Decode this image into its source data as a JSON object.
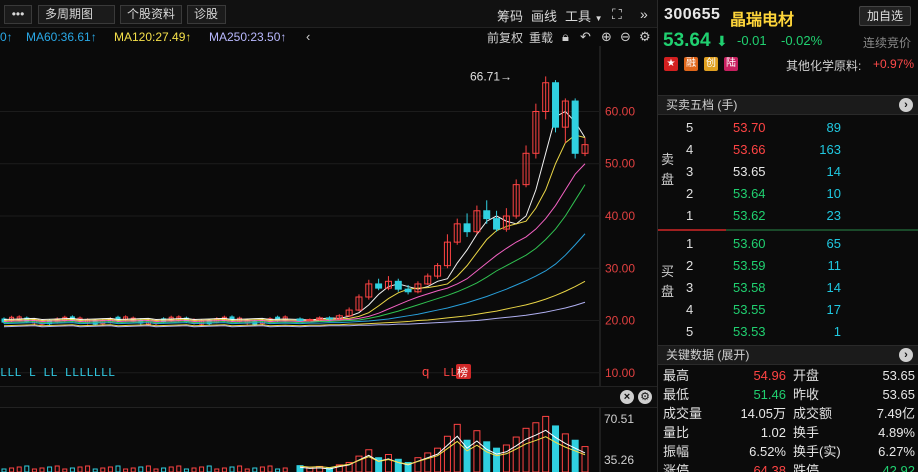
{
  "toolbar": {
    "more_label": "•••",
    "period_label": "多周期图",
    "profile_label": "个股资料",
    "diagnose_label": "诊股",
    "chips_label": "筹码",
    "draw_label": "画线",
    "tools_label": "工具"
  },
  "ma_bar": {
    "prev_label": "0↑",
    "ma60": "MA60:36.61↑",
    "ma120": "MA120:27.49↑",
    "ma250": "MA250:23.50↑",
    "colors": {
      "ma60": "#2aa8e6",
      "ma120": "#f5e04a",
      "ma250": "#b9b9ff"
    }
  },
  "chart_controls": {
    "adjust_label": "前复权",
    "overlay_label": "重载"
  },
  "chart_data": {
    "type": "candlestick",
    "title": "",
    "y_ticks": [
      "60.00",
      "50.00",
      "40.00",
      "30.00",
      "20.00",
      "10.00"
    ],
    "ylim": [
      9,
      71
    ],
    "high_label": "66.71→",
    "series": [
      {
        "name": "MA5",
        "values": [
          20.2,
          20.1,
          20.3,
          20.5,
          20.4,
          20.8,
          21.5,
          23.0,
          25.0,
          26.5,
          27.0,
          26.5,
          26.0,
          26.5,
          27.5,
          28.0,
          31.0,
          33.5,
          36.5,
          39.0,
          40.0,
          39.0,
          38.5,
          40.0,
          45.0,
          52.0,
          59.0,
          60.0,
          58.0,
          55.0
        ]
      },
      {
        "name": "MA10",
        "values": [
          20.0,
          20.0,
          20.1,
          20.2,
          20.3,
          20.4,
          20.8,
          21.5,
          22.8,
          24.2,
          25.3,
          26.0,
          26.2,
          26.3,
          26.6,
          27.0,
          28.5,
          30.5,
          33.0,
          35.5,
          37.2,
          38.0,
          38.5,
          39.0,
          41.5,
          45.0,
          50.0,
          54.0,
          55.5,
          55.0
        ]
      },
      {
        "name": "MA20",
        "values": [
          19.8,
          19.9,
          19.9,
          20.0,
          20.1,
          20.2,
          20.4,
          20.8,
          21.4,
          22.2,
          23.0,
          23.8,
          24.5,
          25.1,
          25.7,
          26.2,
          27.0,
          28.0,
          29.5,
          31.0,
          32.5,
          33.8,
          35.0,
          36.0,
          37.5,
          39.5,
          42.0,
          45.0,
          48.0,
          50.0
        ]
      },
      {
        "name": "MA30",
        "values": [
          19.6,
          19.7,
          19.8,
          19.8,
          19.9,
          20.0,
          20.1,
          20.4,
          20.8,
          21.3,
          21.8,
          22.4,
          23.0,
          23.6,
          24.2,
          24.8,
          25.5,
          26.3,
          27.2,
          28.3,
          29.5,
          30.5,
          31.5,
          32.5,
          33.8,
          35.5,
          37.5,
          40.0,
          43.0,
          46.0
        ]
      },
      {
        "name": "MA60",
        "values": [
          19.4,
          19.5,
          19.5,
          19.6,
          19.6,
          19.7,
          19.8,
          19.9,
          20.1,
          20.3,
          20.6,
          20.9,
          21.2,
          21.6,
          22.0,
          22.4,
          22.9,
          23.4,
          24.0,
          24.6,
          25.3,
          26.0,
          26.8,
          27.6,
          28.5,
          29.5,
          30.8,
          32.5,
          34.5,
          36.6
        ]
      },
      {
        "name": "MA120",
        "values": [
          19.0,
          19.1,
          19.1,
          19.2,
          19.2,
          19.3,
          19.3,
          19.4,
          19.5,
          19.6,
          19.7,
          19.8,
          20.0,
          20.1,
          20.3,
          20.5,
          20.7,
          20.9,
          21.2,
          21.5,
          21.8,
          22.2,
          22.6,
          23.0,
          23.5,
          24.1,
          24.8,
          25.6,
          26.5,
          27.5
        ]
      },
      {
        "name": "MA250",
        "values": [
          18.8,
          18.9,
          18.9,
          19.0,
          19.0,
          19.0,
          19.1,
          19.1,
          19.2,
          19.2,
          19.3,
          19.3,
          19.4,
          19.5,
          19.6,
          19.7,
          19.8,
          19.9,
          20.0,
          20.2,
          20.4,
          20.6,
          20.8,
          21.0,
          21.3,
          21.6,
          22.0,
          22.4,
          22.9,
          23.5
        ]
      }
    ],
    "candles": [
      [
        20.3,
        20.0,
        20.6,
        19.8
      ],
      [
        20.0,
        20.2,
        20.4,
        19.8
      ],
      [
        20.2,
        20.5,
        20.8,
        20.0
      ],
      [
        20.5,
        20.3,
        20.8,
        20.0
      ],
      [
        20.3,
        20.9,
        21.2,
        20.1
      ],
      [
        20.9,
        22.0,
        22.5,
        20.7
      ],
      [
        22.0,
        24.5,
        25.0,
        21.8
      ],
      [
        24.5,
        27.0,
        27.8,
        24.0
      ],
      [
        27.0,
        26.2,
        28.0,
        25.8
      ],
      [
        26.2,
        27.5,
        28.5,
        25.8
      ],
      [
        27.5,
        26.0,
        28.0,
        25.5
      ],
      [
        26.0,
        25.5,
        26.8,
        25.0
      ],
      [
        25.5,
        27.0,
        27.5,
        25.2
      ],
      [
        27.0,
        28.5,
        29.0,
        26.8
      ],
      [
        28.5,
        30.5,
        31.0,
        28.0
      ],
      [
        30.5,
        35.0,
        36.5,
        30.0
      ],
      [
        35.0,
        38.5,
        39.5,
        34.5
      ],
      [
        38.5,
        37.0,
        40.5,
        36.0
      ],
      [
        37.0,
        41.0,
        42.0,
        36.5
      ],
      [
        41.0,
        39.5,
        43.0,
        38.5
      ],
      [
        39.5,
        37.5,
        41.0,
        37.0
      ],
      [
        37.5,
        40.0,
        41.5,
        37.0
      ],
      [
        40.0,
        46.0,
        47.0,
        39.5
      ],
      [
        46.0,
        52.0,
        53.5,
        45.5
      ],
      [
        52.0,
        60.0,
        61.5,
        51.0
      ],
      [
        60.0,
        65.5,
        66.71,
        58.5
      ],
      [
        65.5,
        57.0,
        66.0,
        56.0
      ],
      [
        57.0,
        62.0,
        62.5,
        54.0
      ],
      [
        62.0,
        52.0,
        62.5,
        51.0
      ],
      [
        52.0,
        53.65,
        54.96,
        51.46
      ]
    ],
    "markers_left": "LLL L  LL LLLLLLL",
    "marker_tag": "榜",
    "marker_q": "q"
  },
  "volume": {
    "ticks": [
      "70.51",
      "35.26"
    ],
    "values": [
      8,
      6,
      7,
      5,
      9,
      12,
      20,
      28,
      18,
      22,
      16,
      12,
      18,
      24,
      30,
      45,
      60,
      40,
      52,
      38,
      30,
      34,
      44,
      55,
      62,
      70,
      58,
      48,
      40,
      32
    ]
  },
  "stock": {
    "code": "300655",
    "name": "晶瑞电材",
    "add_label": "加自选",
    "price": "53.64",
    "change": "-0.01",
    "change_pct": "-0.02%",
    "auction_label": "连续竞价",
    "flags": [
      "中",
      "融",
      "创",
      "陆"
    ],
    "flag_colors": [
      "#d32020",
      "#e0661a",
      "#e0a020",
      "#c82060"
    ],
    "industry_label": "其他化学原料:",
    "industry_chg": "+0.97%"
  },
  "orderbook": {
    "title": "买卖五档 (手)",
    "sell_label": "卖盘",
    "buy_label": "买盘",
    "sell": [
      {
        "level": "5",
        "price": "53.70",
        "vol": "89",
        "color": "red"
      },
      {
        "level": "4",
        "price": "53.66",
        "vol": "163",
        "color": "red"
      },
      {
        "level": "3",
        "price": "53.65",
        "vol": "14",
        "color": "white"
      },
      {
        "level": "2",
        "price": "53.64",
        "vol": "10",
        "color": "green"
      },
      {
        "level": "1",
        "price": "53.62",
        "vol": "23",
        "color": "green"
      }
    ],
    "buy": [
      {
        "level": "1",
        "price": "53.60",
        "vol": "65",
        "color": "green"
      },
      {
        "level": "2",
        "price": "53.59",
        "vol": "11",
        "color": "green"
      },
      {
        "level": "3",
        "price": "53.58",
        "vol": "14",
        "color": "green"
      },
      {
        "level": "4",
        "price": "53.55",
        "vol": "17",
        "color": "green"
      },
      {
        "level": "5",
        "price": "53.53",
        "vol": "1",
        "color": "green"
      }
    ]
  },
  "key_data": {
    "title": "关键数据 (展开)",
    "rows": [
      {
        "l1": "最高",
        "v1": "54.96",
        "c1": "red",
        "l2": "开盘",
        "v2": "53.65",
        "c2": "white"
      },
      {
        "l1": "最低",
        "v1": "51.46",
        "c1": "green",
        "l2": "昨收",
        "v2": "53.65",
        "c2": "white"
      },
      {
        "l1": "成交量",
        "v1": "14.05万",
        "c1": "white",
        "l2": "成交额",
        "v2": "7.49亿",
        "c2": "white"
      },
      {
        "l1": "量比",
        "v1": "1.02",
        "c1": "white",
        "l2": "换手",
        "v2": "4.89%",
        "c2": "white"
      },
      {
        "l1": "振幅",
        "v1": "6.52%",
        "c1": "white",
        "l2": "换手(实)",
        "v2": "6.27%",
        "c2": "white"
      },
      {
        "l1": "涨停",
        "v1": "64.38",
        "c1": "red",
        "l2": "跌停",
        "v2": "42.92",
        "c2": "green"
      }
    ]
  }
}
